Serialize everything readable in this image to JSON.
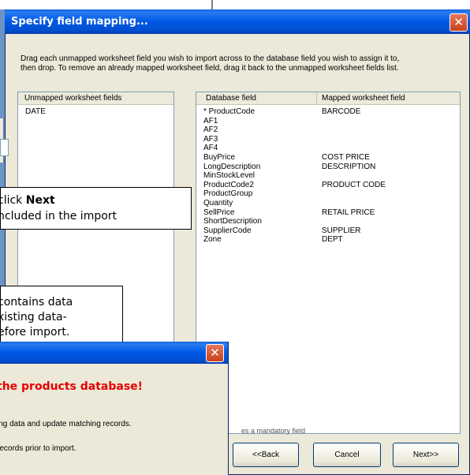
{
  "dialog": {
    "title": "Specify field mapping...",
    "close_glyph": "✕",
    "instruction_line1": "Drag each unmapped worksheet field you wish to import across to the database field you wish to assign it to,",
    "instruction_line2": "then drop.  To remove an already mapped worksheet field, drag it back to the unmapped worksheet fields list."
  },
  "unmapped": {
    "header": "Unmapped worksheet fields",
    "items": [
      "DATE"
    ]
  },
  "mapping": {
    "col_db": "Database field",
    "col_mapped": "Mapped worksheet field",
    "rows": [
      {
        "db": "* ProductCode",
        "mapped": "BARCODE"
      },
      {
        "db": "AF1",
        "mapped": ""
      },
      {
        "db": "AF2",
        "mapped": ""
      },
      {
        "db": "AF3",
        "mapped": ""
      },
      {
        "db": "AF4",
        "mapped": ""
      },
      {
        "db": "BuyPrice",
        "mapped": "COST PRICE"
      },
      {
        "db": "LongDescription",
        "mapped": "DESCRIPTION"
      },
      {
        "db": "MinStockLevel",
        "mapped": ""
      },
      {
        "db": "ProductCode2",
        "mapped": "PRODUCT CODE"
      },
      {
        "db": "ProductGroup",
        "mapped": ""
      },
      {
        "db": "Quantity",
        "mapped": ""
      },
      {
        "db": "SellPrice",
        "mapped": "RETAIL PRICE"
      },
      {
        "db": "ShortDescription",
        "mapped": ""
      },
      {
        "db": "SupplierCode",
        "mapped": "SUPPLIER"
      },
      {
        "db": "Zone",
        "mapped": "DEPT"
      }
    ]
  },
  "footnote": "es a mandatory field",
  "buttons": {
    "back": "<<Back",
    "cancel": "Cancel",
    "next": "Next>>"
  },
  "callout1": {
    "line1_prefix": "click ",
    "line1_bold": "Next",
    "line2": "ncluded in the import"
  },
  "callout2": {
    "line1": "contains data",
    "line2": "xisting data-",
    "line3": "efore import."
  },
  "warning": {
    "close_glyph": "✕",
    "title": " the products database!",
    "line1": "ing data and update matching records.",
    "line2": "records prior to import."
  }
}
